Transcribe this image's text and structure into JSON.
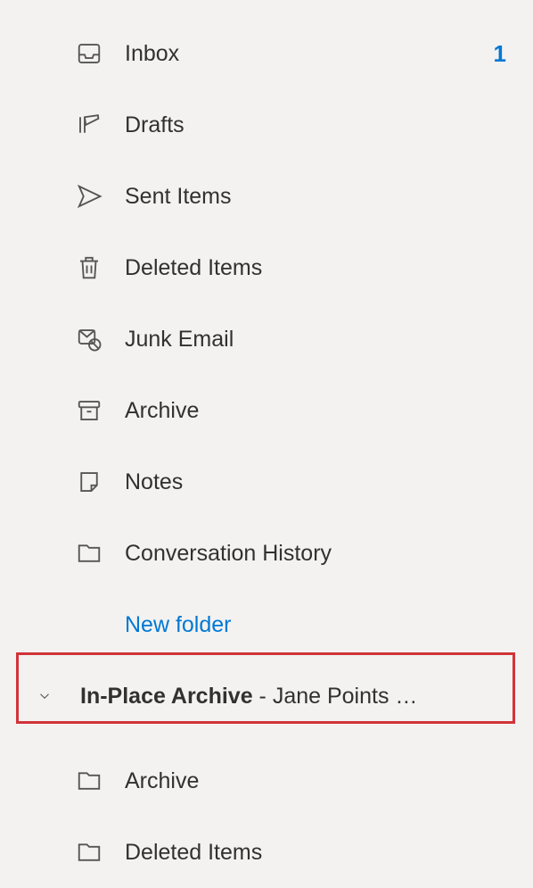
{
  "folders": [
    {
      "id": "inbox",
      "icon": "inbox-icon",
      "label": "Inbox",
      "count": "1"
    },
    {
      "id": "drafts",
      "icon": "drafts-icon",
      "label": "Drafts",
      "count": null
    },
    {
      "id": "sent-items",
      "icon": "sent-icon",
      "label": "Sent Items",
      "count": null
    },
    {
      "id": "deleted-items",
      "icon": "trash-icon",
      "label": "Deleted Items",
      "count": null
    },
    {
      "id": "junk-email",
      "icon": "junk-icon",
      "label": "Junk Email",
      "count": null
    },
    {
      "id": "archive",
      "icon": "archive-icon",
      "label": "Archive",
      "count": null
    },
    {
      "id": "notes",
      "icon": "notes-icon",
      "label": "Notes",
      "count": null
    },
    {
      "id": "conversation-history",
      "icon": "folder-icon",
      "label": "Conversation History",
      "count": null
    }
  ],
  "new_folder_label": "New folder",
  "archive_section": {
    "title_bold": "In-Place Archive",
    "title_normal": " - Jane Points …",
    "expanded": true,
    "folders": [
      {
        "id": "archive-archive",
        "icon": "folder-icon",
        "label": "Archive",
        "count": null
      },
      {
        "id": "archive-deleted-items",
        "icon": "folder-icon",
        "label": "Deleted Items",
        "count": null
      }
    ]
  }
}
